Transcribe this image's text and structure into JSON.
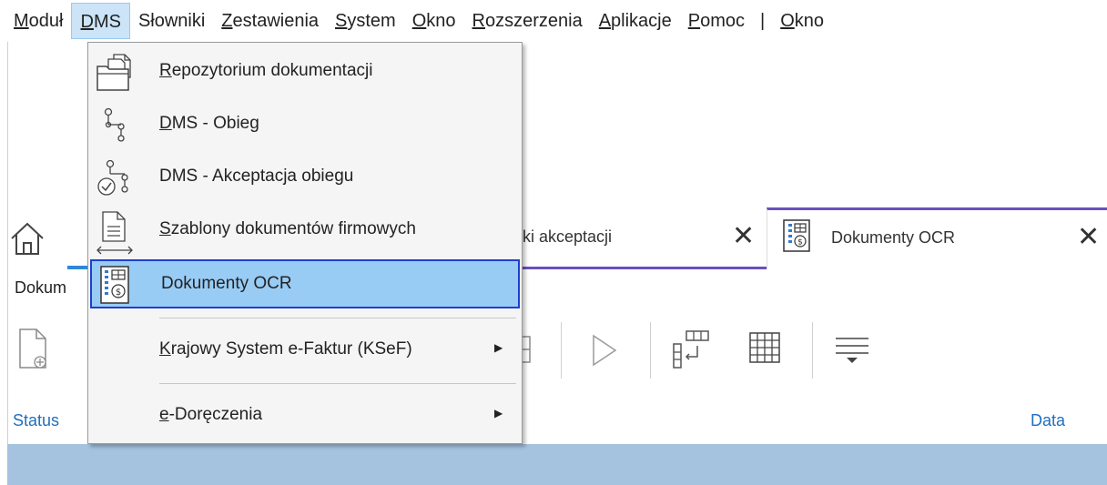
{
  "menubar": {
    "items": [
      "Moduł",
      "DMS",
      "Słowniki",
      "Zestawienia",
      "System",
      "Okno",
      "Rozszerzenia",
      "Aplikacje",
      "Pomoc"
    ],
    "separator": "|",
    "extra": "Okno"
  },
  "dropdown": {
    "items": [
      {
        "label": "Repozytorium dokumentacji",
        "icon": "folder-documents-icon"
      },
      {
        "label": "DMS - Obieg",
        "icon": "workflow-icon"
      },
      {
        "label": "DMS - Akceptacja obiegu",
        "icon": "workflow-accept-icon"
      },
      {
        "label": "Szablony dokumentów firmowych",
        "icon": "document-template-icon"
      },
      {
        "label": "Dokumenty OCR",
        "icon": "ocr-document-icon",
        "selected": true
      },
      {
        "label": "Krajowy System e-Faktur (KSeF)",
        "submenu": true
      },
      {
        "label": "e-Doręczenia",
        "submenu": true
      }
    ]
  },
  "tabs": {
    "acceptance_tab_label": "ki akceptacji",
    "ocr_tab_label": "Dokumenty OCR",
    "close_symbol": "✕"
  },
  "doc_label": "Dokum",
  "columns": {
    "status": "Status",
    "data": "Data"
  },
  "colors": {
    "selection_bg": "#99ccf5",
    "selection_border": "#1e3fcf",
    "tab_accent": "#6b4fbf",
    "column_header": "#1f6fbf",
    "list_band": "#a5c3df"
  }
}
